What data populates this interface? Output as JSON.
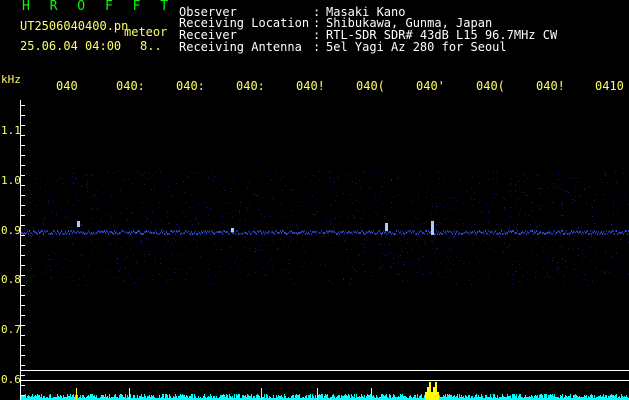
{
  "header": {
    "app_name": "H R O F F T",
    "file_name": "UT2506040400.pn",
    "mode_label": "meteor",
    "timestamp": "25.06.04 04:00",
    "count": "8..",
    "fields": [
      {
        "label": "Observer",
        "value": "Masaki Kano"
      },
      {
        "label": "Receiving Location",
        "value": "Shibukawa, Gunma, Japan"
      },
      {
        "label": "Receiver",
        "value": "RTL-SDR SDR# 43dB L15 96.7MHz CW"
      },
      {
        "label": "Receiving Antenna",
        "value": "5el Yagi Az 280 for Seoul"
      }
    ]
  },
  "spectrogram": {
    "y_unit": "kHz",
    "y_ticks": [
      "1.1",
      "1.0",
      "0.9",
      "0.8",
      "0.7",
      "0.6"
    ],
    "x_ticks": [
      "040",
      "0402",
      "0403",
      "0404",
      "0405",
      "0406",
      "0407",
      "0408",
      "0409",
      "0410"
    ],
    "x_tick_display": [
      "040",
      "040:",
      "040:",
      "040:",
      "040!",
      "040(",
      "040'",
      "040(",
      "040!",
      "0410"
    ],
    "colors": {
      "background": "#000000",
      "grid": "#ffffff",
      "axis_text": "#ffff66",
      "signal": "#3355ff",
      "bright_signal": "#aaccff",
      "activity_bar": "#00ffff",
      "activity_peak": "#ffff00"
    }
  }
}
